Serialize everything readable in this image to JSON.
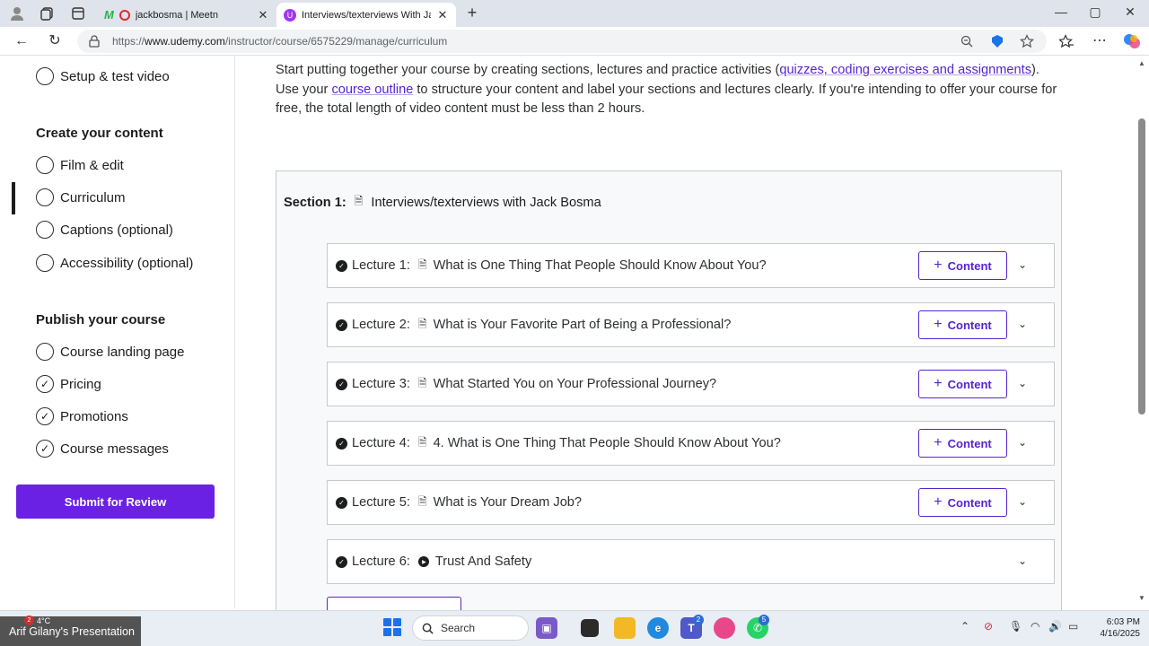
{
  "browser": {
    "tabs": [
      {
        "title": "jackbosma | Meetn",
        "active": false
      },
      {
        "title": "Interviews/texterviews With Jack B",
        "active": true
      }
    ],
    "new_tab": "+",
    "window_controls": {
      "minimize": "—",
      "maximize": "▢",
      "close": "✕"
    },
    "url_prefix": "https://",
    "url_host": "www.udemy.com",
    "url_path": "/instructor/course/6575229/manage/curriculum"
  },
  "sidebar": {
    "top_item": "Setup & test video",
    "create_heading": "Create your content",
    "create_items": [
      {
        "label": "Film & edit",
        "checked": false
      },
      {
        "label": "Curriculum",
        "checked": false,
        "active": true
      },
      {
        "label": "Captions (optional)",
        "checked": false
      },
      {
        "label": "Accessibility (optional)",
        "checked": false
      }
    ],
    "publish_heading": "Publish your course",
    "publish_items": [
      {
        "label": "Course landing page",
        "checked": false
      },
      {
        "label": "Pricing",
        "checked": true
      },
      {
        "label": "Promotions",
        "checked": true
      },
      {
        "label": "Course messages",
        "checked": true
      }
    ],
    "submit_label": "Submit for Review"
  },
  "intro": {
    "part1": "Start putting together your course by creating sections, lectures and practice activities (",
    "link1": "quizzes, coding exercises and assignments",
    "part2": "). Use your ",
    "link2": "course outline",
    "part3": " to structure your content and label your sections and lectures clearly. If you're intending to offer your course for free, the total length of video content must be less than 2 hours."
  },
  "section": {
    "label": "Section 1:",
    "title": "Interviews/texterviews with Jack Bosma"
  },
  "lectures": [
    {
      "label": "Lecture 1:",
      "title": "What is One Thing That People Should Know About You?",
      "type": "doc",
      "has_content_button": true
    },
    {
      "label": "Lecture 2:",
      "title": "What is Your Favorite Part of Being a Professional?",
      "type": "doc",
      "has_content_button": true
    },
    {
      "label": "Lecture 3:",
      "title": "What Started You on Your Professional Journey?",
      "type": "doc",
      "has_content_button": true
    },
    {
      "label": "Lecture 4:",
      "title": "4. What is One Thing That People Should Know About You?",
      "type": "doc",
      "has_content_button": true
    },
    {
      "label": "Lecture 5:",
      "title": "What is Your Dream Job?",
      "type": "doc",
      "has_content_button": true
    },
    {
      "label": "Lecture 6:",
      "title": "Trust And Safety",
      "type": "video",
      "has_content_button": false
    }
  ],
  "content_button_label": "Content",
  "taskbar": {
    "presenter": "Arif Gilany's Presentation",
    "weather_temp": "4°C",
    "weather_badge": "2",
    "search_label": "Search",
    "teams_badge": "2",
    "whatsapp_badge": "5",
    "time": "6:03 PM",
    "date": "4/16/2025"
  }
}
